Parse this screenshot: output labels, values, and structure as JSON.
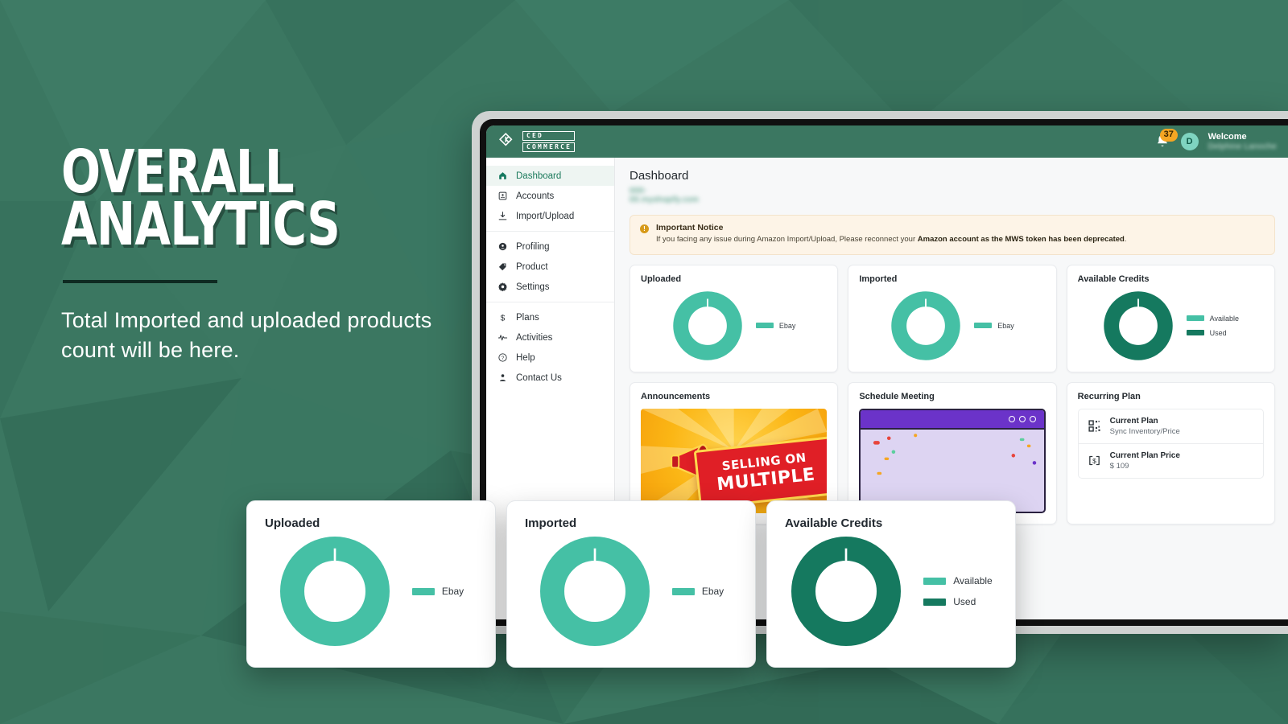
{
  "promo": {
    "title": "OVERALL\nANALYTICS",
    "subtitle": "Total Imported and uploaded products count will be here."
  },
  "colors": {
    "background_green": "#3b7761",
    "brand_green": "#3b7761",
    "teal": "#45c0a5",
    "dark_green": "#15795f",
    "notice_bg": "#fdf4e7",
    "badge_orange": "#f5a623"
  },
  "topbar": {
    "logo_line1": "CED",
    "logo_line2": "COMMERCE",
    "logo_icon": "ced-diamond-logo-icon",
    "bell_icon": "notification-bell-icon",
    "notification_count": "37",
    "avatar_initial": "D",
    "welcome_label": "Welcome",
    "welcome_name": "Delphine Lanoche"
  },
  "sidebar": {
    "groups": [
      {
        "items": [
          {
            "label": "Dashboard",
            "icon": "home-icon",
            "active": true
          },
          {
            "label": "Accounts",
            "icon": "id-card-icon",
            "active": false
          },
          {
            "label": "Import/Upload",
            "icon": "download-icon",
            "active": false
          }
        ]
      },
      {
        "items": [
          {
            "label": "Profiling",
            "icon": "user-circle-icon",
            "active": false
          },
          {
            "label": "Product",
            "icon": "tag-icon",
            "active": false
          },
          {
            "label": "Settings",
            "icon": "gear-icon",
            "active": false
          }
        ]
      },
      {
        "items": [
          {
            "label": "Plans",
            "icon": "dollar-icon",
            "active": false
          },
          {
            "label": "Activities",
            "icon": "activity-line-icon",
            "active": false
          },
          {
            "label": "Help",
            "icon": "question-mark-icon",
            "active": false
          },
          {
            "label": "Contact Us",
            "icon": "person-icon",
            "active": false
          }
        ]
      }
    ]
  },
  "main": {
    "page_title": "Dashboard",
    "page_subtitle": "000-00.myshopify.com",
    "notice": {
      "icon": "alert-exclamation-icon",
      "title": "Important Notice",
      "text_plain": "If you facing any issue during Amazon Import/Upload, Please reconnect your ",
      "text_bold": "Amazon account as the MWS token has been deprecated",
      "text_tail": "."
    },
    "cards": {
      "uploaded_title": "Uploaded",
      "imported_title": "Imported",
      "credits_title": "Available Credits",
      "announcements_title": "Announcements",
      "schedule_title": "Schedule Meeting",
      "recurring_title": "Recurring Plan"
    },
    "announcement_banner": {
      "line1": "SELLING ON",
      "line2": "MULTIPLE"
    },
    "recurring_plan_rows": [
      {
        "icon": "qr-code-icon",
        "key": "Current Plan",
        "value": "Sync Inventory/Price"
      },
      {
        "icon": "money-bill-icon",
        "key": "Current Plan Price",
        "value": "$ 109"
      }
    ]
  },
  "callout": {
    "cards": [
      {
        "title": "Uploaded"
      },
      {
        "title": "Imported"
      },
      {
        "title": "Available Credits"
      }
    ]
  },
  "chart_data": [
    {
      "type": "pie",
      "title": "Uploaded",
      "labels": [
        "Ebay"
      ],
      "values": [
        100
      ],
      "colors": [
        "#45c0a5"
      ],
      "donut": true,
      "legend_position": "right"
    },
    {
      "type": "pie",
      "title": "Imported",
      "labels": [
        "Ebay"
      ],
      "values": [
        100
      ],
      "colors": [
        "#45c0a5"
      ],
      "donut": true,
      "legend_position": "right"
    },
    {
      "type": "pie",
      "title": "Available Credits",
      "labels": [
        "Available",
        "Used"
      ],
      "values": [
        0,
        100
      ],
      "colors": [
        "#45c0a5",
        "#15795f"
      ],
      "donut": true,
      "legend_position": "right"
    }
  ]
}
